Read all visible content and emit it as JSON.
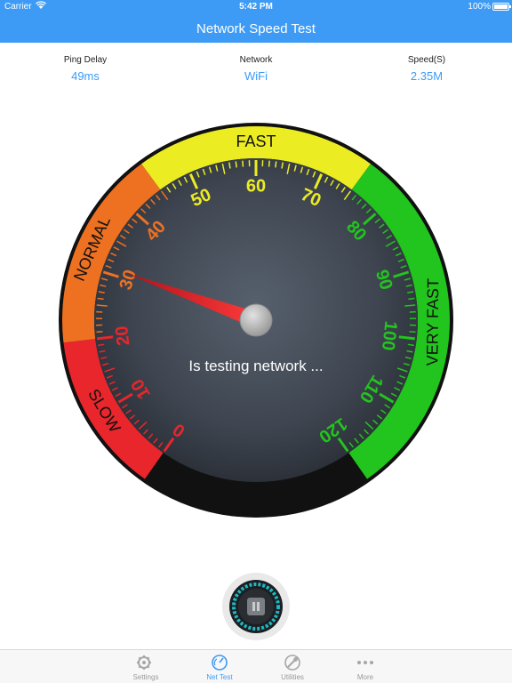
{
  "status_bar": {
    "carrier": "Carrier",
    "time": "5:42 PM",
    "battery": "100%"
  },
  "header": {
    "title": "Network Speed Test"
  },
  "stats": [
    {
      "label": "Ping Delay",
      "value": "49ms"
    },
    {
      "label": "Network",
      "value": "WiFi"
    },
    {
      "label": "Speed(S)",
      "value": "2.35M"
    }
  ],
  "gauge": {
    "min": 0,
    "max": 120,
    "needle_value": 31,
    "status_text": "Is testing network ...",
    "tick_labels": [
      "0",
      "10",
      "20",
      "30",
      "40",
      "50",
      "60",
      "70",
      "80",
      "90",
      "100",
      "110",
      "120"
    ],
    "zones": [
      {
        "name": "SLOW",
        "from": 0,
        "to": 20,
        "color": "#e8262c",
        "label_color": "#e8262c"
      },
      {
        "name": "NORMAL",
        "from": 20,
        "to": 45,
        "color": "#ee7122",
        "label_color": "#ee7122"
      },
      {
        "name": "FAST",
        "from": 45,
        "to": 75,
        "color": "#ecec23",
        "label_color": "#ecec23"
      },
      {
        "name": "VERY FAST",
        "from": 75,
        "to": 120,
        "color": "#22c51d",
        "label_color": "#22c51d"
      }
    ]
  },
  "control": {
    "icon": "pause-icon"
  },
  "tabbar": {
    "tabs": [
      {
        "label": "Settings",
        "icon": "settings-gear-icon",
        "active": false
      },
      {
        "label": "Net Test",
        "icon": "speedometer-icon",
        "active": true
      },
      {
        "label": "Utilities",
        "icon": "utilities-wrench-icon",
        "active": false
      },
      {
        "label": "More",
        "icon": "more-dots-icon",
        "active": false
      }
    ]
  },
  "colors": {
    "accent": "#3d9bf5",
    "gauge_face": "#3e4550",
    "needle": "#e8262c"
  }
}
